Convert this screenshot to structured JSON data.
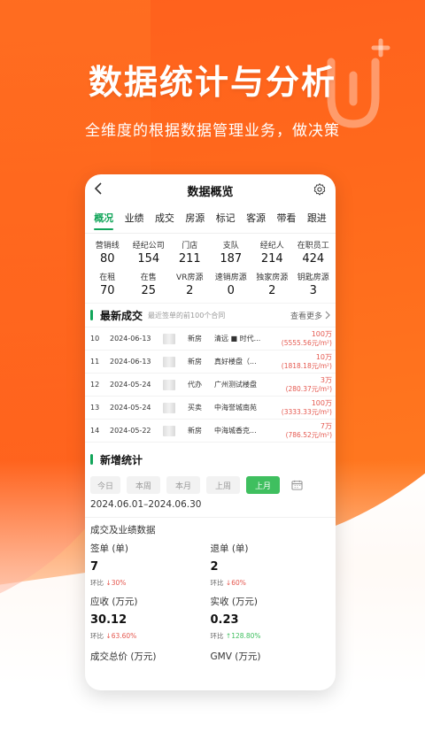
{
  "promo": {
    "headline": "数据统计与分析",
    "subline": "全维度的根据数据管理业务，做决策"
  },
  "app": {
    "title": "数据概览",
    "back_icon": "chevron-left-icon",
    "settings_icon": "gear-icon"
  },
  "tabs": [
    "概况",
    "业绩",
    "成交",
    "房源",
    "标记",
    "客源",
    "带看",
    "跟进"
  ],
  "active_tab": "概况",
  "stats": [
    {
      "label": "营销线",
      "value": "80"
    },
    {
      "label": "经纪公司",
      "value": "154"
    },
    {
      "label": "门店",
      "value": "211"
    },
    {
      "label": "支队",
      "value": "187"
    },
    {
      "label": "经纪人",
      "value": "214"
    },
    {
      "label": "在职员工",
      "value": "424"
    },
    {
      "label": "在租",
      "value": "70"
    },
    {
      "label": "在售",
      "value": "25"
    },
    {
      "label": "VR房源",
      "value": "2"
    },
    {
      "label": "速销房源",
      "value": "0"
    },
    {
      "label": "独家房源",
      "value": "2"
    },
    {
      "label": "钥匙房源",
      "value": "3"
    }
  ],
  "latest": {
    "title": "最新成交",
    "subtitle": "最近签单的前100个合同",
    "more": "查看更多",
    "rows": [
      {
        "no": "10",
        "date": "2024-06-13",
        "kind": "新房",
        "name": "清远 ■ 时代...",
        "price": "100万",
        "unit": "(5555.56元/m²)"
      },
      {
        "no": "11",
        "date": "2024-06-13",
        "kind": "新房",
        "name": "真好楼盘（...",
        "price": "10万",
        "unit": "(1818.18元/m²)"
      },
      {
        "no": "12",
        "date": "2024-05-24",
        "kind": "代办",
        "name": "广州测试楼盘",
        "price": "3万",
        "unit": "(280.37元/m²)"
      },
      {
        "no": "13",
        "date": "2024-05-24",
        "kind": "买卖",
        "name": "中海誉城南苑",
        "price": "100万",
        "unit": "(3333.33元/m²)"
      },
      {
        "no": "14",
        "date": "2024-05-22",
        "kind": "新房",
        "name": "中海城香克...",
        "price": "7万",
        "unit": "(786.52元/m²)"
      }
    ]
  },
  "new_stats": {
    "title": "新增统计",
    "filters": [
      "今日",
      "本周",
      "本月",
      "上周",
      "上月"
    ],
    "active_filter": "上月",
    "calendar_icon": "calendar-icon",
    "range": "2024.06.01–2024.06.30"
  },
  "performance": {
    "title": "成交及业绩数据",
    "cells": [
      {
        "label": "签单 (单)",
        "value": "7",
        "change_label": "环比",
        "change": "30%",
        "dir": "down"
      },
      {
        "label": "退单 (单)",
        "value": "2",
        "change_label": "环比",
        "change": "60%",
        "dir": "down"
      },
      {
        "label": "应收 (万元)",
        "value": "30.12",
        "change_label": "环比",
        "change": "63.60%",
        "dir": "down"
      },
      {
        "label": "实收 (万元)",
        "value": "0.23",
        "change_label": "环比",
        "change": "128.80%",
        "dir": "up"
      }
    ],
    "bottom": [
      "成交总价 (万元)",
      "GMV (万元)"
    ]
  }
}
